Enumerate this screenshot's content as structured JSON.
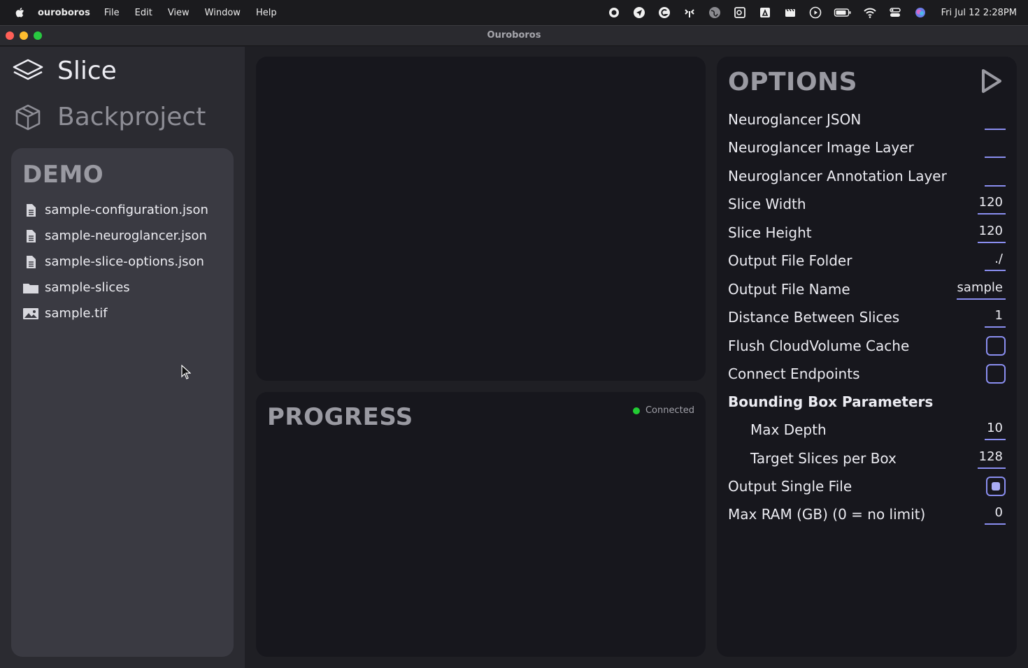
{
  "menubar": {
    "app_name": "ouroboros",
    "items": [
      "File",
      "Edit",
      "View",
      "Window",
      "Help"
    ],
    "clock": "Fri Jul 12  2:28PM",
    "status_icons": [
      "record-icon",
      "send-icon",
      "grammarly-icon",
      "antenna-icon",
      "globe-icon",
      "outlook-icon",
      "drive-icon",
      "clapper-icon",
      "play-icon",
      "battery-icon",
      "wifi-icon",
      "control-center-icon",
      "siri-icon"
    ]
  },
  "window": {
    "title": "Ouroboros"
  },
  "sidebar": {
    "nav": [
      {
        "label": "Slice",
        "icon": "layers-icon"
      },
      {
        "label": "Backproject",
        "icon": "cube-icon"
      }
    ],
    "demo": {
      "title": "DEMO",
      "files": [
        {
          "name": "sample-configuration.json",
          "icon": "file-icon"
        },
        {
          "name": "sample-neuroglancer.json",
          "icon": "file-icon"
        },
        {
          "name": "sample-slice-options.json",
          "icon": "file-icon"
        },
        {
          "name": "sample-slices",
          "icon": "folder-icon"
        },
        {
          "name": "sample.tif",
          "icon": "image-icon"
        }
      ]
    }
  },
  "progress": {
    "title": "PROGRESS",
    "status": "Connected",
    "status_color": "#22cc33"
  },
  "options": {
    "title": "OPTIONS",
    "fields": {
      "neuroglancer_json": {
        "label": "Neuroglancer JSON",
        "value": ""
      },
      "image_layer": {
        "label": "Neuroglancer Image Layer",
        "value": ""
      },
      "annotation_layer": {
        "label": "Neuroglancer Annotation Layer",
        "value": ""
      },
      "slice_width": {
        "label": "Slice Width",
        "value": "120"
      },
      "slice_height": {
        "label": "Slice Height",
        "value": "120"
      },
      "output_folder": {
        "label": "Output File Folder",
        "value": "./"
      },
      "output_name": {
        "label": "Output File Name",
        "value": "sample"
      },
      "distance": {
        "label": "Distance Between Slices",
        "value": "1"
      },
      "flush_cache": {
        "label": "Flush CloudVolume Cache",
        "checked": false
      },
      "connect_endpoints": {
        "label": "Connect Endpoints",
        "checked": false
      },
      "bbox_header": {
        "label": "Bounding Box Parameters"
      },
      "max_depth": {
        "label": "Max Depth",
        "value": "10"
      },
      "target_slices": {
        "label": "Target Slices per Box",
        "value": "128"
      },
      "single_file": {
        "label": "Output Single File",
        "checked": true
      },
      "max_ram": {
        "label": "Max RAM (GB) (0 = no limit)",
        "value": "0"
      }
    },
    "accent_color": "#8a8ef0"
  }
}
